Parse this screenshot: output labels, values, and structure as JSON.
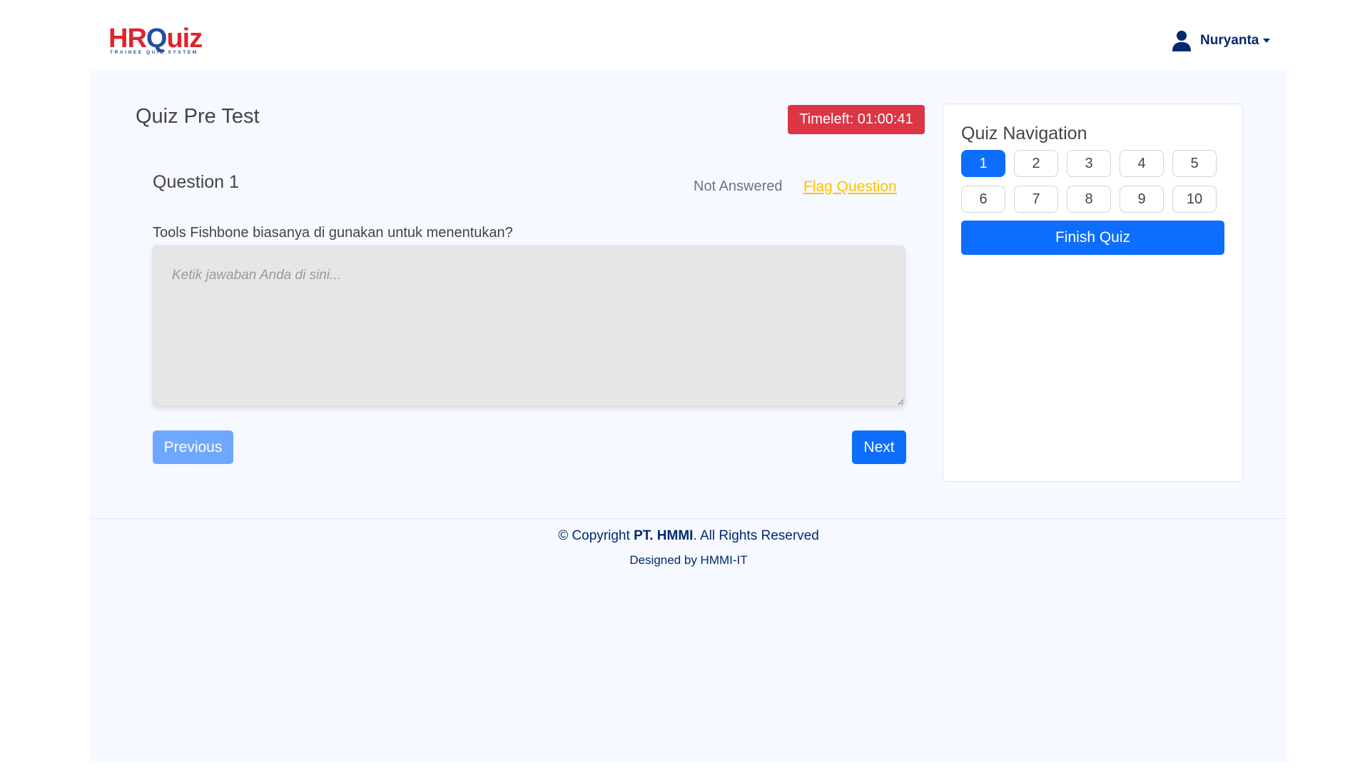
{
  "brand": {
    "logo_main_hr": "HR",
    "logo_main_q": "Q",
    "logo_main_rest": "uiz",
    "logo_sub": "TRAINEE QUIZ SYSTEM"
  },
  "user": {
    "name": "Nuryanta",
    "icon": "person-icon"
  },
  "quiz": {
    "title": "Quiz Pre Test",
    "timer": "Timeleft: 01:00:41"
  },
  "question": {
    "label": "Question 1",
    "status": "Not Answered",
    "flag_label": "Flag Question",
    "text": "Tools Fishbone biasanya di gunakan untuk menentukan?",
    "answer_placeholder": "Ketik jawaban Anda di sini..."
  },
  "buttons": {
    "previous": "Previous",
    "next": "Next"
  },
  "navigation": {
    "title": "Quiz Navigation",
    "items": [
      "1",
      "2",
      "3",
      "4",
      "5",
      "6",
      "7",
      "8",
      "9",
      "10"
    ],
    "active_index": 0,
    "finish_label": "Finish Quiz"
  },
  "footer": {
    "copy_prefix": "© Copyright ",
    "company": "PT. HMMI",
    "copy_suffix": ". All Rights Reserved",
    "designed_by": "Designed by HMMI-IT"
  },
  "colors": {
    "primary": "#0d6efd",
    "danger": "#dc3545",
    "warning": "#ffc107",
    "navy": "#012970"
  }
}
